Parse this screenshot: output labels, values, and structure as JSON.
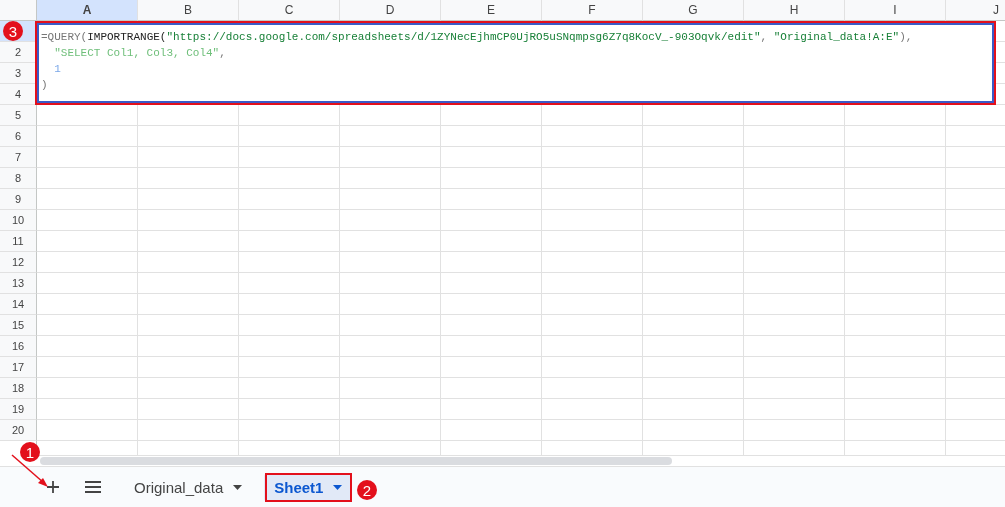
{
  "columns": [
    {
      "label": "A",
      "selected": true
    },
    {
      "label": "B",
      "selected": false
    },
    {
      "label": "C",
      "selected": false
    },
    {
      "label": "D",
      "selected": false
    },
    {
      "label": "E",
      "selected": false
    },
    {
      "label": "F",
      "selected": false
    },
    {
      "label": "G",
      "selected": false
    },
    {
      "label": "H",
      "selected": false
    },
    {
      "label": "I",
      "selected": false
    },
    {
      "label": "J",
      "selected": false
    }
  ],
  "first_row_selected": true,
  "rows": [
    {
      "label": "2"
    },
    {
      "label": "3"
    },
    {
      "label": "4"
    },
    {
      "label": "5"
    },
    {
      "label": "6"
    },
    {
      "label": "7"
    },
    {
      "label": "8"
    },
    {
      "label": "9"
    },
    {
      "label": "10"
    },
    {
      "label": "11"
    },
    {
      "label": "12"
    },
    {
      "label": "13"
    },
    {
      "label": "14"
    },
    {
      "label": "15"
    },
    {
      "label": "16"
    },
    {
      "label": "17"
    },
    {
      "label": "18"
    },
    {
      "label": "19"
    },
    {
      "label": "20"
    }
  ],
  "formula": {
    "lines": [
      {
        "tokens": [
          {
            "text": "=QUERY(",
            "kind": "punct"
          },
          {
            "text": "IMPORTRANGE(",
            "kind": "function"
          },
          {
            "text": "\"https://docs.google.com/spreadsheets/d/1ZYNecEjhmCP0UjRO5uSNqmpsg6Z7q8KocV_-903Oqvk/edit\"",
            "kind": "string"
          },
          {
            "text": ", ",
            "kind": "punct"
          },
          {
            "text": "\"Original_data!A:E\"",
            "kind": "string"
          },
          {
            "text": "),",
            "kind": "punct"
          }
        ]
      },
      {
        "tokens": [
          {
            "text": "\"SELECT Col1, Col3, Col4\"",
            "kind": "dim-string"
          },
          {
            "text": ",",
            "kind": "punct"
          }
        ]
      },
      {
        "tokens": [
          {
            "text": "1",
            "kind": "number"
          }
        ]
      },
      {
        "tokens": [
          {
            "text": ")",
            "kind": "punct"
          }
        ]
      }
    ]
  },
  "sheet_tabs": [
    {
      "label": "Original_data",
      "selected": false
    },
    {
      "label": "Sheet1",
      "selected": true
    }
  ],
  "markers": [
    {
      "label": "3"
    },
    {
      "label": "1"
    },
    {
      "label": "2"
    }
  ]
}
